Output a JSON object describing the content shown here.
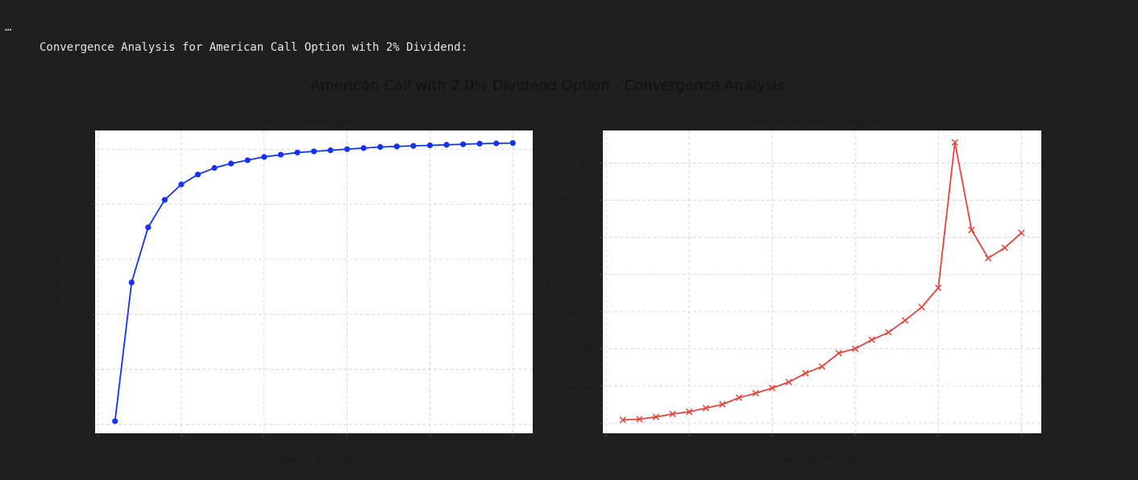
{
  "output": {
    "ellipsis": "…",
    "stdout": "Convergence Analysis for American Call Option with 2% Dividend:"
  },
  "figure": {
    "suptitle": "American Call with 2.0% Dividend Option - Convergence Analysis"
  },
  "chart_data": [
    {
      "type": "line",
      "title": "Price Convergence",
      "xlabel": "Number of Steps",
      "ylabel": "Option Price",
      "xlim": [
        -0.2,
        26.2
      ],
      "ylim": [
        7.92,
        10.67
      ],
      "xticks": [
        0,
        5,
        10,
        15,
        20,
        25
      ],
      "yticks": [
        8.0,
        8.5,
        9.0,
        9.5,
        10.0,
        10.5
      ],
      "ytick_labels": [
        "8.0",
        "8.5",
        "9.0",
        "9.5",
        "10.0",
        "10.5"
      ],
      "grid": true,
      "color": "#1432f5",
      "marker": "o",
      "x": [
        1,
        2,
        3,
        4,
        5,
        6,
        7,
        8,
        9,
        10,
        11,
        12,
        13,
        14,
        15,
        16,
        17,
        18,
        19,
        20,
        21,
        22,
        23,
        24,
        25
      ],
      "values": [
        8.03,
        9.29,
        9.79,
        10.04,
        10.18,
        10.27,
        10.33,
        10.37,
        10.4,
        10.43,
        10.45,
        10.47,
        10.48,
        10.49,
        10.5,
        10.51,
        10.52,
        10.525,
        10.53,
        10.535,
        10.54,
        10.545,
        10.55,
        10.553,
        10.556
      ]
    },
    {
      "type": "line",
      "title": "Computational Complexity",
      "xlabel": "Number of Steps",
      "ylabel": "Computation Time (s)",
      "xlim": [
        -0.2,
        26.2
      ],
      "ylim": [
        -7e-05,
        0.00197
      ],
      "xticks": [
        0,
        5,
        10,
        15,
        20,
        25
      ],
      "yticks": [
        0,
        0.00025,
        0.0005,
        0.00075,
        0.001,
        0.00125,
        0.0015,
        0.00175
      ],
      "ytick_labels": [
        "0.00000",
        "0.00025",
        "0.00050",
        "0.00075",
        "0.00100",
        "0.00125",
        "0.00150",
        "0.00175"
      ],
      "grid": true,
      "color": "#e8433d",
      "marker": "x",
      "x": [
        1,
        2,
        3,
        4,
        5,
        6,
        7,
        8,
        9,
        10,
        11,
        12,
        13,
        14,
        15,
        16,
        17,
        18,
        19,
        20,
        21,
        22,
        23,
        24,
        25
      ],
      "values": [
        2e-05,
        2.5e-05,
        4e-05,
        6e-05,
        7.5e-05,
        0.0001,
        0.000125,
        0.00017,
        0.0002,
        0.000235,
        0.000275,
        0.000335,
        0.00038,
        0.00047,
        0.0005,
        0.00056,
        0.00061,
        0.00069,
        0.00078,
        0.00091,
        0.00189,
        0.0013,
        0.00111,
        0.00118,
        0.00128
      ]
    }
  ]
}
